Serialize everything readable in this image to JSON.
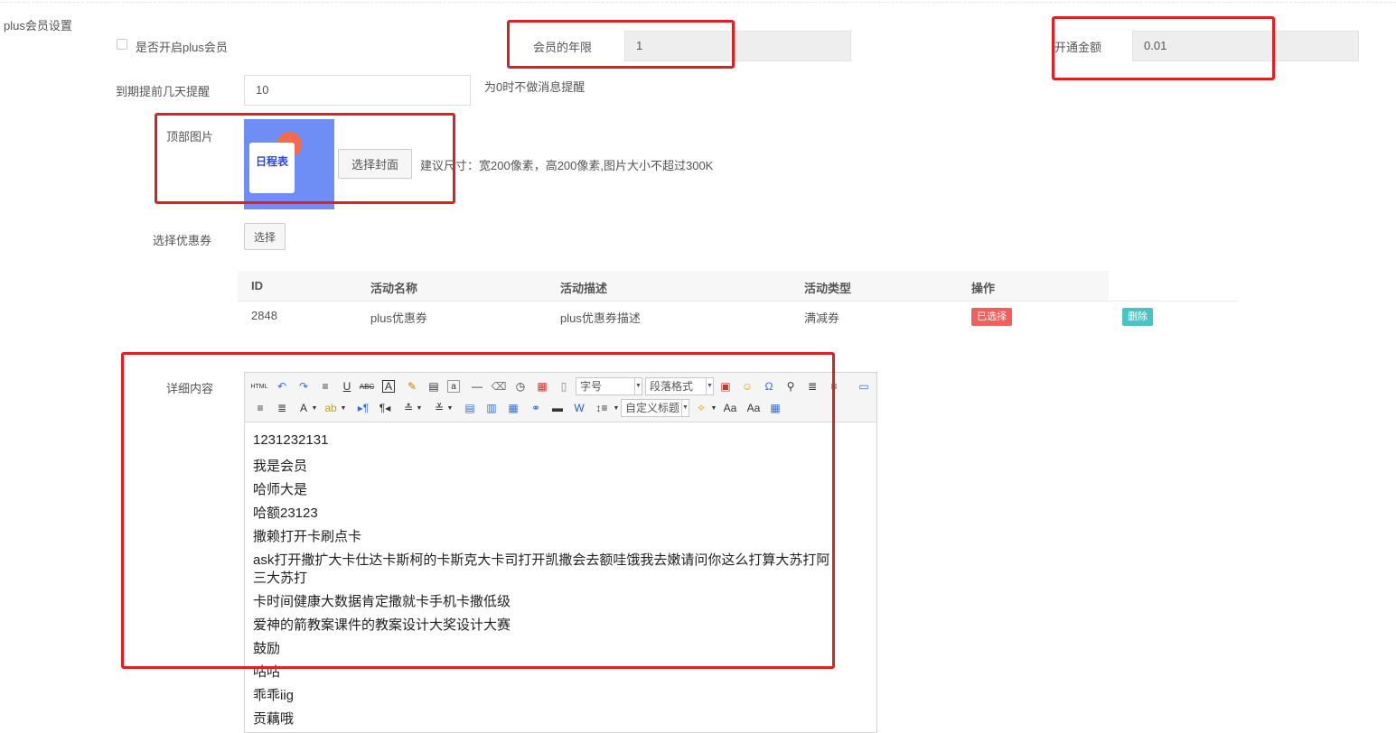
{
  "section": {
    "title": "plus会员设置"
  },
  "plus_enable": {
    "label": "是否开启plus会员",
    "checked": false
  },
  "member_years": {
    "label": "会员的年限",
    "value": "1"
  },
  "open_amount": {
    "label": "开通金额",
    "value": "0.01"
  },
  "remind_days": {
    "label": "到期提前几天提醒",
    "value": "10",
    "hint": "为0时不做消息提醒"
  },
  "top_image": {
    "label": "顶部图片",
    "choose_button": "选择封面",
    "hint": "建议尺寸：宽200像素，高200像素,图片大小不超过300K",
    "thumb_text": "日程表"
  },
  "coupon": {
    "label": "选择优惠券",
    "select_button": "选择",
    "columns": [
      "ID",
      "活动名称",
      "活动描述",
      "活动类型",
      "操作"
    ],
    "rows": [
      {
        "id": "2848",
        "name": "plus优惠券",
        "desc": "plus优惠券描述",
        "type": "满减券",
        "status_tag": "已选择",
        "delete_tag": "删除"
      }
    ],
    "colors": {
      "selected": "#f05f5f",
      "delete": "#4cc3c3"
    }
  },
  "detail": {
    "label": "详细内容",
    "toolbar": {
      "font_size_placeholder": "字号",
      "paragraph_format": "段落格式",
      "custom_title": "自定义标题",
      "html_label": "HTML"
    },
    "lines": [
      "1231232131",
      "我是会员",
      "哈师大是",
      "哈额23123",
      "撒赖打开卡刷点卡",
      "ask打开撒扩大卡仕达卡斯柯的卡斯克大卡司打开凯撒会去额哇饿我去嫩请问你这么打算大苏打阿",
      "三大苏打",
      "卡时间健康大数据肯定撒就卡手机卡撒低级",
      "爱神的箭教案课件的教案设计大奖设计大赛",
      "鼓励",
      "咕咕",
      "乖乖iig",
      "贡藕哦"
    ]
  },
  "annotation_color": "#e02020"
}
